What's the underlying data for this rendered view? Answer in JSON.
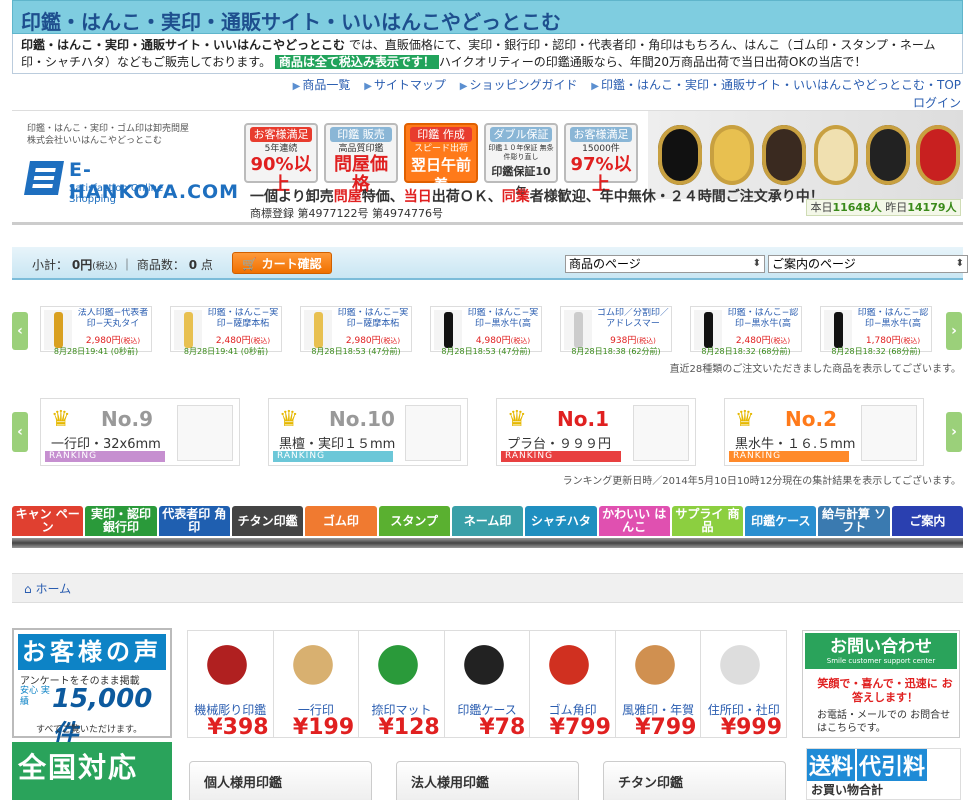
{
  "title": "印鑑・はんこ・実印・通販サイト・いいはんこやどっとこむ",
  "intro": {
    "site": "印鑑・はんこ・実印・通販サイト・いいはんこやどっとこむ",
    "text1": " では、直販価格にて、実印・銀行印・認印・代表者印・角印はもちろん、はんこ（ゴム印・スタンプ・ネーム印・シャチハタ）などもご販売しております。",
    "badge": "商品は全て税込み表示です！",
    "text2": "ハイクオリティーの印鑑通販なら、年間20万商品出荷で当日出荷OKの当店で！"
  },
  "toplinks": [
    "商品一覧",
    "サイトマップ",
    "ショッピングガイド",
    "印鑑・はんこ・実印・通販サイト・いいはんこやどっとこむ・TOP"
  ],
  "login": "ログイン",
  "header": {
    "company1": "印鑑・はんこ・実印・ゴム印は卸売問屋",
    "company2": "株式会社いいはんこやどっとこむ",
    "logo": "E-HANKOYA.COM",
    "logo_sub": "Satisfaction Online Shopping",
    "promos": [
      {
        "top": "お客様満足",
        "mid": "5年連続",
        "big": "90%以上"
      },
      {
        "top": "印鑑 販売",
        "mid": "高品質印鑑",
        "big": "問屋価格"
      },
      {
        "top": "印鑑 作成",
        "mid": "スピード出荷",
        "big": "翌日午前着"
      },
      {
        "top": "ダブル保証",
        "mid": "印鑑１０年保証 無条件彫り直し",
        "big": "印鑑保証10年"
      },
      {
        "top": "お客様満足",
        "mid": "15000件",
        "big": "97%以上"
      }
    ],
    "tagline_a": "一個より卸売",
    "tagline_b": "問屋",
    "tagline_c": "特価、",
    "tagline_d": "当日",
    "tagline_e": "出荷ＯＫ、",
    "tagline_f": "同業",
    "tagline_g": "者様歓迎、年中無休・２４時間ご注文承り中！",
    "trademark": "商標登録 第4977122号 第4974776号",
    "counter_today_label": "本日",
    "counter_today": "11648人",
    "counter_yesterday_label": "昨日",
    "counter_yesterday": "14179人"
  },
  "cart": {
    "subtotal_label": "小計：",
    "subtotal": "0円",
    "tax": "(税込)",
    "count_label": "商品数：",
    "count": "0",
    "count_unit": "点",
    "button": "カート確認",
    "select1": "商品のページ",
    "select2": "ご案内のページ"
  },
  "recent": [
    {
      "name": "法人印鑑−代表者印−天丸タイ",
      "price": "2,980円",
      "time": "8月28日19:41 (0秒前)",
      "color": "#d9a020"
    },
    {
      "name": "印鑑・はんこ−実印−薩摩本柘",
      "price": "2,480円",
      "time": "8月28日19:41 (0秒前)",
      "color": "#e8c050"
    },
    {
      "name": "印鑑・はんこ−実印−薩摩本柘",
      "price": "2,980円",
      "time": "8月28日18:53 (47分前)",
      "color": "#e8c050"
    },
    {
      "name": "印鑑・はんこ−実印−黒水牛(高",
      "price": "4,980円",
      "time": "8月28日18:53 (47分前)",
      "color": "#111111"
    },
    {
      "name": "ゴム印／分割印／アドレスマー",
      "price": "938円",
      "time": "8月28日18:38 (62分前)",
      "color": "#cccccc"
    },
    {
      "name": "印鑑・はんこ−認印−黒水牛(高",
      "price": "2,480円",
      "time": "8月28日18:32 (68分前)",
      "color": "#111111"
    },
    {
      "name": "印鑑・はんこ−認印−黒水牛(高",
      "price": "1,780円",
      "time": "8月28日18:32 (68分前)",
      "color": "#111111"
    }
  ],
  "recent_tax": "(税込)",
  "recent_note": "直近28種類のご注文いただきました商品を表示してございます。",
  "ranking": [
    {
      "no": "No.9",
      "name": "一行印・32x6mm",
      "label": "RANKING",
      "color": "#c68fd0"
    },
    {
      "no": "No.10",
      "name": "黒檀・実印１５mm",
      "label": "RANKING",
      "color": "#6cc7d8"
    },
    {
      "no": "No.1",
      "name": "プラ台・９９９円",
      "label": "RANKING",
      "color": "#e84040"
    },
    {
      "no": "No.2",
      "name": "黒水牛・１６.５mm",
      "label": "RANKING",
      "color": "#ff8a2a"
    }
  ],
  "ranking_note": "ランキング更新日時／2014年5月10日10時12分現在の集計結果を表示してございます。",
  "nav": [
    {
      "label": "キャン ペーン",
      "color": "#e04030"
    },
    {
      "label": "実印・認印 銀行印",
      "color": "#2a9a3a"
    },
    {
      "label": "代表者印 角印",
      "color": "#1f5fb0"
    },
    {
      "label": "チタン印鑑",
      "color": "#444444"
    },
    {
      "label": "ゴム印",
      "color": "#f07a30"
    },
    {
      "label": "スタンプ",
      "color": "#5ab030"
    },
    {
      "label": "ネーム印",
      "color": "#3aa0a8"
    },
    {
      "label": "シャチハタ",
      "color": "#1f8fc0"
    },
    {
      "label": "かわいい はんこ",
      "color": "#e050b0"
    },
    {
      "label": "サプライ 商品",
      "color": "#8ccf40"
    },
    {
      "label": "印鑑ケース",
      "color": "#2a8fd0"
    },
    {
      "label": "給与計算 ソフト",
      "color": "#3a7ab0"
    },
    {
      "label": "ご案内",
      "color": "#2a40b0"
    }
  ],
  "breadcrumb": "ホーム",
  "voice": {
    "title": "お客様の声",
    "sub": "アンケートをそのまま掲載",
    "note": "安心 実績",
    "count": "15,000件",
    "link": "すべてご覧いただけます。"
  },
  "nation": "全国対応",
  "tiles": [
    {
      "name": "機械彫り印鑑",
      "price": "¥398"
    },
    {
      "name": "一行印",
      "price": "¥199"
    },
    {
      "name": "捺印マット",
      "price": "¥128"
    },
    {
      "name": "印鑑ケース",
      "price": "¥78"
    },
    {
      "name": "ゴム角印",
      "price": "¥799"
    },
    {
      "name": "風雅印・年賀",
      "price": "¥799"
    },
    {
      "name": "住所印・社印",
      "price": "¥999"
    }
  ],
  "categories": [
    "個人様用印鑑",
    "法人様用印鑑",
    "チタン印鑑"
  ],
  "contact": {
    "title": "お問い合わせ",
    "sub": "Smile customer support center",
    "red": "笑顔で・喜んで・迅速に お答えします！",
    "body": "お電話・メールでの お問合せはこちらです。"
  },
  "ship": {
    "a": "送料",
    "b": "代引料",
    "sub": "お買い物合計"
  }
}
